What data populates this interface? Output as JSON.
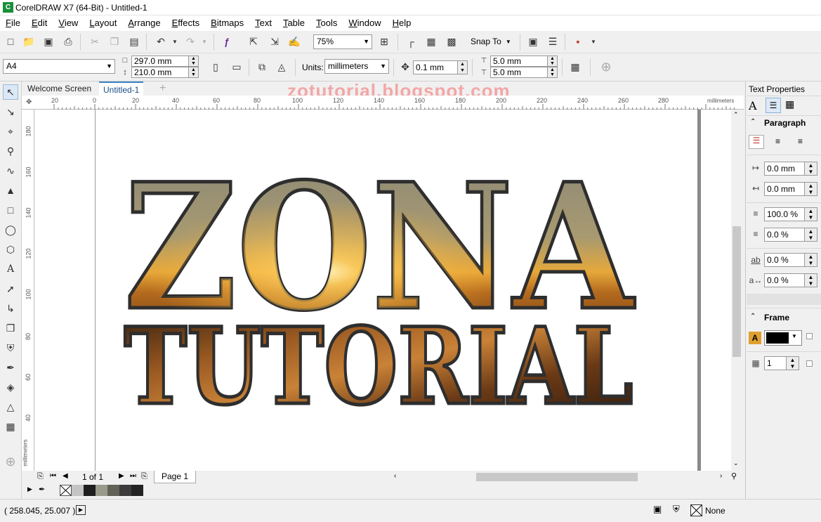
{
  "window": {
    "title": "CorelDRAW X7 (64-Bit) - Untitled-1"
  },
  "menu": [
    "File",
    "Edit",
    "View",
    "Layout",
    "Arrange",
    "Effects",
    "Bitmaps",
    "Text",
    "Table",
    "Tools",
    "Window",
    "Help"
  ],
  "toolbar": {
    "zoom": "75%",
    "snap_to": "Snap To"
  },
  "propertybar": {
    "page_size": "A4",
    "width": "297.0 mm",
    "height": "210.0 mm",
    "units_label": "Units:",
    "units": "millimeters",
    "nudge": "0.1 mm",
    "dup_x": "5.0 mm",
    "dup_y": "5.0 mm"
  },
  "tabs": {
    "welcome": "Welcome Screen",
    "doc": "Untitled-1"
  },
  "watermark": "zotutorial.blogspot.com",
  "ruler": {
    "h_ticks": [
      "20",
      "0",
      "20",
      "40",
      "60",
      "80",
      "100",
      "120",
      "140",
      "160",
      "180",
      "200",
      "220",
      "240",
      "260",
      "280"
    ],
    "units": "millimeters",
    "v_ticks": [
      "180",
      "160",
      "140",
      "120",
      "100",
      "80",
      "60",
      "40"
    ],
    "v_units": "millimeters"
  },
  "artwork": {
    "line1": "ZONA",
    "line2": "TUTORIAL"
  },
  "pagebar": {
    "count": "1 of 1",
    "page_tab": "Page 1"
  },
  "palette": {
    "colors": [
      "#ffffff",
      "#c4c4c4",
      "#1e1e1e",
      "#9a9a8a",
      "#626259",
      "#3b3b3b",
      "#232323"
    ]
  },
  "status": {
    "coords": "( 258.045, 25.007 )",
    "fill": "None"
  },
  "docker": {
    "title": "Text Properties",
    "paragraph": "Paragraph",
    "left_indent": "0.0 mm",
    "right_indent": "0.0 mm",
    "line_spacing": "100.0 %",
    "para_spacing": "0.0 %",
    "char_spacing": "0.0 %",
    "word_spacing": "0.0 %",
    "frame": "Frame",
    "frame_columns": "1",
    "frame_color": "#000000"
  }
}
